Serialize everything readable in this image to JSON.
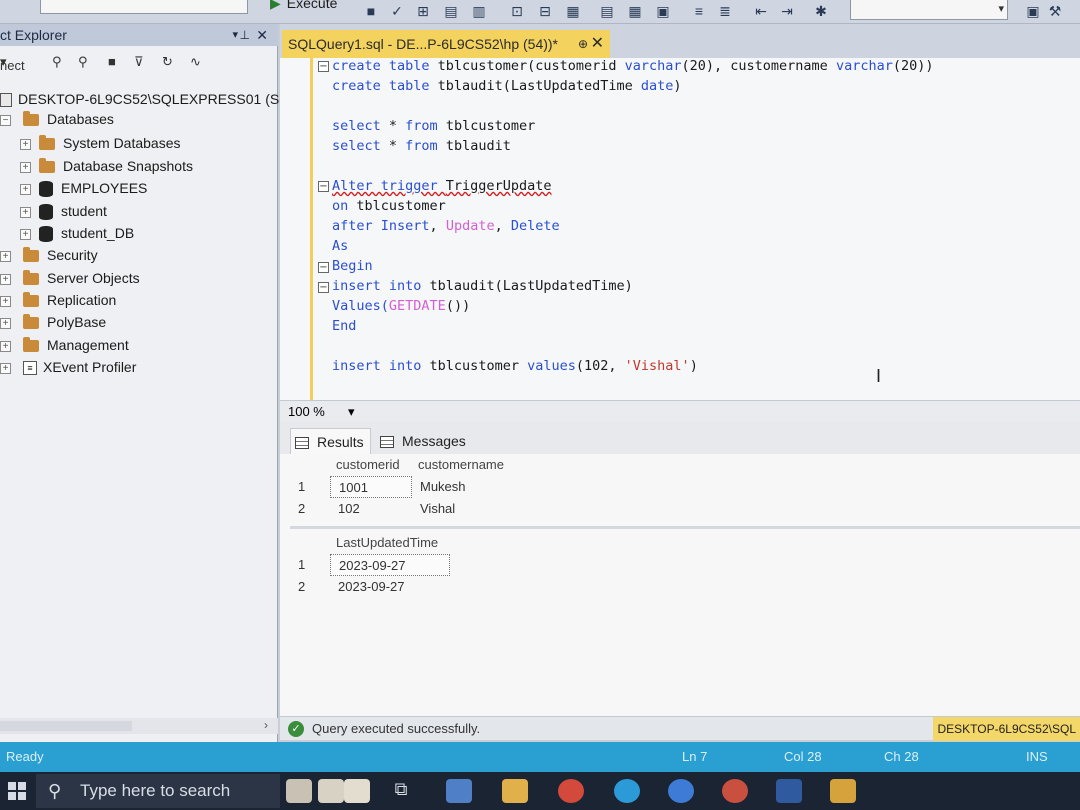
{
  "toolbar": {
    "execute_label": "Execute"
  },
  "object_explorer": {
    "title": "ct Explorer",
    "connect_label": "nect",
    "server": "DESKTOP-6L9CS52\\SQLEXPRESS01 (SC",
    "databases_label": "Databases",
    "db_items": [
      "System Databases",
      "Database Snapshots",
      "EMPLOYEES",
      "student",
      "student_DB"
    ],
    "server_items": [
      "Security",
      "Server Objects",
      "Replication",
      "PolyBase",
      "Management",
      "XEvent Profiler"
    ]
  },
  "tab": {
    "title": "SQLQuery1.sql - DE...P-6L9CS52\\hp (54))*",
    "pin": "⊕",
    "close": "✕"
  },
  "editor": {
    "lines": [
      [
        "create table ",
        "tblcustomer(customerid ",
        "varchar",
        "(20), customername ",
        "varchar",
        "(20))"
      ],
      [
        "create table ",
        "tblaudit(LastUpdatedTime ",
        "date",
        ")"
      ],
      [
        "select ",
        "* ",
        "from ",
        "tblcustomer"
      ],
      [
        "select ",
        "* ",
        "from ",
        "tblaudit"
      ],
      [
        "Alter trigger ",
        "TriggerUpdate"
      ],
      [
        "on ",
        "tblcustomer"
      ],
      [
        "after Insert",
        ", ",
        "Update",
        ", ",
        "Delete"
      ],
      [
        "As"
      ],
      [
        "Begin"
      ],
      [
        "insert into ",
        "tblaudit(LastUpdatedTime)"
      ],
      [
        "Values(",
        "GETDATE",
        "())"
      ],
      [
        "End"
      ],
      [
        "insert into ",
        "tblcustomer ",
        "values",
        "(102, ",
        "'Vishal'",
        ")"
      ]
    ]
  },
  "zoom": {
    "value": "100 %"
  },
  "results": {
    "tab_results": "Results",
    "tab_messages": "Messages",
    "grid1": {
      "columns": [
        "customerid",
        "customername"
      ],
      "rows": [
        [
          "1",
          "1001",
          "Mukesh"
        ],
        [
          "2",
          "102",
          "Vishal"
        ]
      ]
    },
    "grid2": {
      "columns": [
        "LastUpdatedTime"
      ],
      "rows": [
        [
          "1",
          "2023-09-27"
        ],
        [
          "2",
          "2023-09-27"
        ]
      ]
    }
  },
  "query_status": {
    "message": "Query executed successfully.",
    "server": "DESKTOP-6L9CS52\\SQL"
  },
  "status_bar": {
    "ready": "Ready",
    "ln": "Ln 7",
    "col": "Col 28",
    "ch": "Ch 28",
    "mode": "INS"
  },
  "taskbar": {
    "search_placeholder": "Type here to search"
  },
  "colors": {
    "accent_tab": "#f3d25e",
    "status_bar": "#2a9fd1",
    "taskbar": "#1b2433",
    "keyword": "#2a4fd0",
    "function": "#d45fd4",
    "string": "#c0392b"
  }
}
